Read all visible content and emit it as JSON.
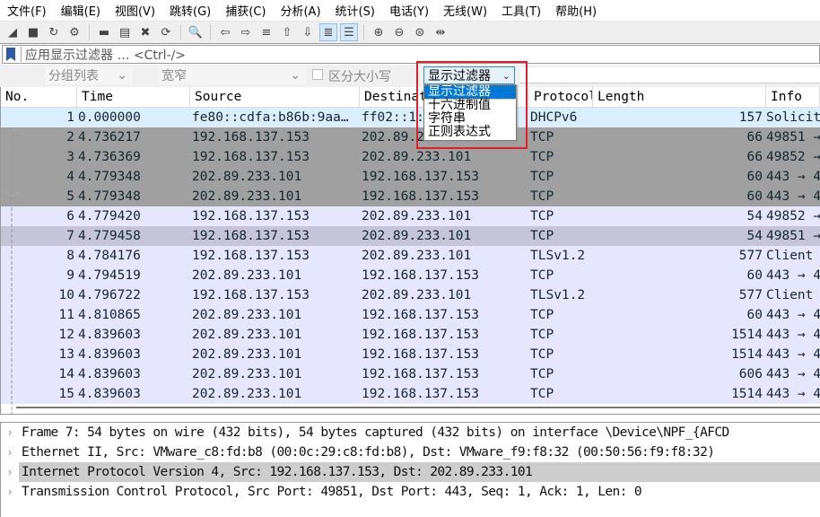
{
  "menu": [
    "文件(F)",
    "编辑(E)",
    "视图(V)",
    "跳转(G)",
    "捕获(C)",
    "分析(A)",
    "统计(S)",
    "电话(Y)",
    "无线(W)",
    "工具(T)",
    "帮助(H)"
  ],
  "toolbar_icons": [
    "shark-fin-start-icon",
    "stop-icon",
    "restart-icon",
    "options-gear-icon",
    "open-folder-icon",
    "save-file-icon",
    "close-file-icon",
    "reload-icon",
    "find-icon",
    "back-arrow-icon",
    "forward-arrow-icon",
    "go-to-packet-icon",
    "first-packet-icon",
    "last-packet-icon",
    "autoscroll-icon",
    "colorize-icon",
    "zoom-in-icon",
    "zoom-out-icon",
    "zoom-normal-icon",
    "resize-columns-icon"
  ],
  "filter": {
    "placeholder": "应用显示过滤器 … <Ctrl-/>"
  },
  "search": {
    "scope": "分组列表",
    "charset": "宽窄",
    "case_label": "区分大小写",
    "case_checked": false,
    "mode": "显示过滤器",
    "mode_options": [
      "显示过滤器",
      "十六进制值",
      "字符串",
      "正则表达式"
    ],
    "value": ""
  },
  "columns": [
    "No.",
    "Time",
    "Source",
    "Destination",
    "Protocol",
    "Length",
    "Info"
  ],
  "packets": [
    {
      "no": "1",
      "time": "0.000000",
      "src": "fe80::cdfa:b86b:9aa…",
      "dst": "ff02::1:2",
      "proto": "DHCPv6",
      "len": "157",
      "info": "Solicit",
      "color": "#dbeeff"
    },
    {
      "no": "2",
      "time": "4.736217",
      "src": "192.168.137.153",
      "dst": "202.89.233.101",
      "proto": "TCP",
      "len": "66",
      "info": "49851 →",
      "color": "#a0a0a0"
    },
    {
      "no": "3",
      "time": "4.736369",
      "src": "192.168.137.153",
      "dst": "202.89.233.101",
      "proto": "TCP",
      "len": "66",
      "info": "49852 →",
      "color": "#a0a0a0"
    },
    {
      "no": "4",
      "time": "4.779348",
      "src": "202.89.233.101",
      "dst": "192.168.137.153",
      "proto": "TCP",
      "len": "60",
      "info": "443 → 4",
      "color": "#a0a0a0"
    },
    {
      "no": "5",
      "time": "4.779348",
      "src": "202.89.233.101",
      "dst": "192.168.137.153",
      "proto": "TCP",
      "len": "60",
      "info": "443 → 4",
      "color": "#a0a0a0"
    },
    {
      "no": "6",
      "time": "4.779420",
      "src": "192.168.137.153",
      "dst": "202.89.233.101",
      "proto": "TCP",
      "len": "54",
      "info": "49852 →",
      "color": "#e7e6ff"
    },
    {
      "no": "7",
      "time": "4.779458",
      "src": "192.168.137.153",
      "dst": "202.89.233.101",
      "proto": "TCP",
      "len": "54",
      "info": "49851 →",
      "color": "#c5c4d8"
    },
    {
      "no": "8",
      "time": "4.784176",
      "src": "192.168.137.153",
      "dst": "202.89.233.101",
      "proto": "TLSv1.2",
      "len": "577",
      "info": "Client",
      "color": "#e7e6ff"
    },
    {
      "no": "9",
      "time": "4.794519",
      "src": "202.89.233.101",
      "dst": "192.168.137.153",
      "proto": "TCP",
      "len": "60",
      "info": "443 → 4",
      "color": "#e7e6ff"
    },
    {
      "no": "10",
      "time": "4.796722",
      "src": "192.168.137.153",
      "dst": "202.89.233.101",
      "proto": "TLSv1.2",
      "len": "577",
      "info": "Client",
      "color": "#e7e6ff"
    },
    {
      "no": "11",
      "time": "4.810865",
      "src": "202.89.233.101",
      "dst": "192.168.137.153",
      "proto": "TCP",
      "len": "60",
      "info": "443 → 4",
      "color": "#e7e6ff"
    },
    {
      "no": "12",
      "time": "4.839603",
      "src": "202.89.233.101",
      "dst": "192.168.137.153",
      "proto": "TCP",
      "len": "1514",
      "info": "443 → 4",
      "color": "#e7e6ff"
    },
    {
      "no": "13",
      "time": "4.839603",
      "src": "202.89.233.101",
      "dst": "192.168.137.153",
      "proto": "TCP",
      "len": "1514",
      "info": "443 → 4",
      "color": "#e7e6ff"
    },
    {
      "no": "14",
      "time": "4.839603",
      "src": "202.89.233.101",
      "dst": "192.168.137.153",
      "proto": "TCP",
      "len": "606",
      "info": "443 → 4",
      "color": "#e7e6ff"
    },
    {
      "no": "15",
      "time": "4.839603",
      "src": "202.89.233.101",
      "dst": "192.168.137.153",
      "proto": "TCP",
      "len": "1514",
      "info": "443 → 4",
      "color": "#e7e6ff"
    }
  ],
  "details": [
    "Frame 7: 54 bytes on wire (432 bits), 54 bytes captured (432 bits) on interface \\Device\\NPF_{AFCD",
    "Ethernet II, Src: VMware_c8:fd:b8 (00:0c:29:c8:fd:b8), Dst: VMware_f9:f8:32 (00:50:56:f9:f8:32)",
    "Internet Protocol Version 4, Src: 192.168.137.153, Dst: 202.89.233.101",
    "Transmission Control Protocol, Src Port: 49851, Dst Port: 443, Seq: 1, Ack: 1, Len: 0"
  ]
}
